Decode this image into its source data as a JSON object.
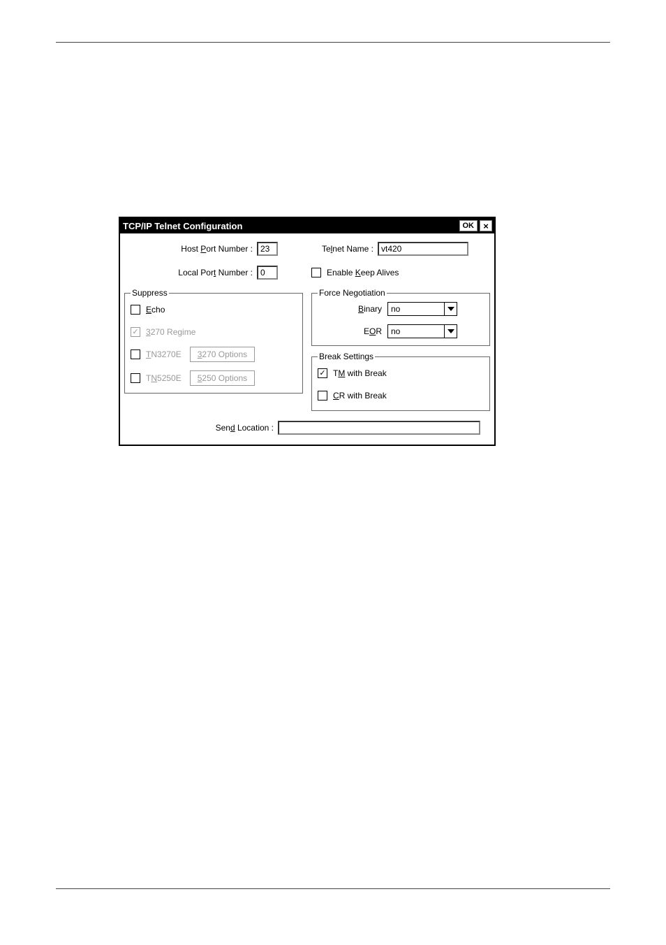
{
  "dialog": {
    "title": "TCP/IP Telnet Configuration",
    "ok": "OK",
    "close": "×"
  },
  "fields": {
    "host_port_label_pre": "Host ",
    "host_port_label_u": "P",
    "host_port_label_post": "ort Number :",
    "host_port_value": "23",
    "local_port_label_pre": "Local Por",
    "local_port_label_u": "t",
    "local_port_label_post": " Number :",
    "local_port_value": "0",
    "telnet_name_label_pre": "Te",
    "telnet_name_label_u": "l",
    "telnet_name_label_post": "net Name :",
    "telnet_name_value": "vt420",
    "send_location_label_pre": "Sen",
    "send_location_label_u": "d",
    "send_location_label_post": " Location :",
    "send_location_value": ""
  },
  "enable_keep": {
    "label_pre": "Enable ",
    "label_u": "K",
    "label_post": "eep Alives",
    "checked": false
  },
  "suppress": {
    "legend": "Suppress",
    "echo_u": "E",
    "echo_post": "cho",
    "echo_checked": false,
    "regime_u": "3",
    "regime_post": "270 Regime",
    "regime_checked": true,
    "tn3270e_u": "T",
    "tn3270e_post": "N3270E",
    "tn3270e_checked": false,
    "btn3270_u": "3",
    "btn3270_post": "270 Options",
    "tn5250e_pre": "T",
    "tn5250e_u": "N",
    "tn5250e_post": "5250E",
    "tn5250e_checked": false,
    "btn5250_u": "5",
    "btn5250_post": "250 Options"
  },
  "force_neg": {
    "legend": "Force Negotiation",
    "binary_u": "B",
    "binary_post": "inary",
    "binary_value": "no",
    "eor_pre": "E",
    "eor_u": "O",
    "eor_post": "R",
    "eor_value": "no"
  },
  "break_settings": {
    "legend": "Break Settings",
    "tm_pre": "T",
    "tm_u": "M",
    "tm_post": " with Break",
    "tm_checked": true,
    "cr_u": "C",
    "cr_post": "R with Break",
    "cr_checked": false
  }
}
